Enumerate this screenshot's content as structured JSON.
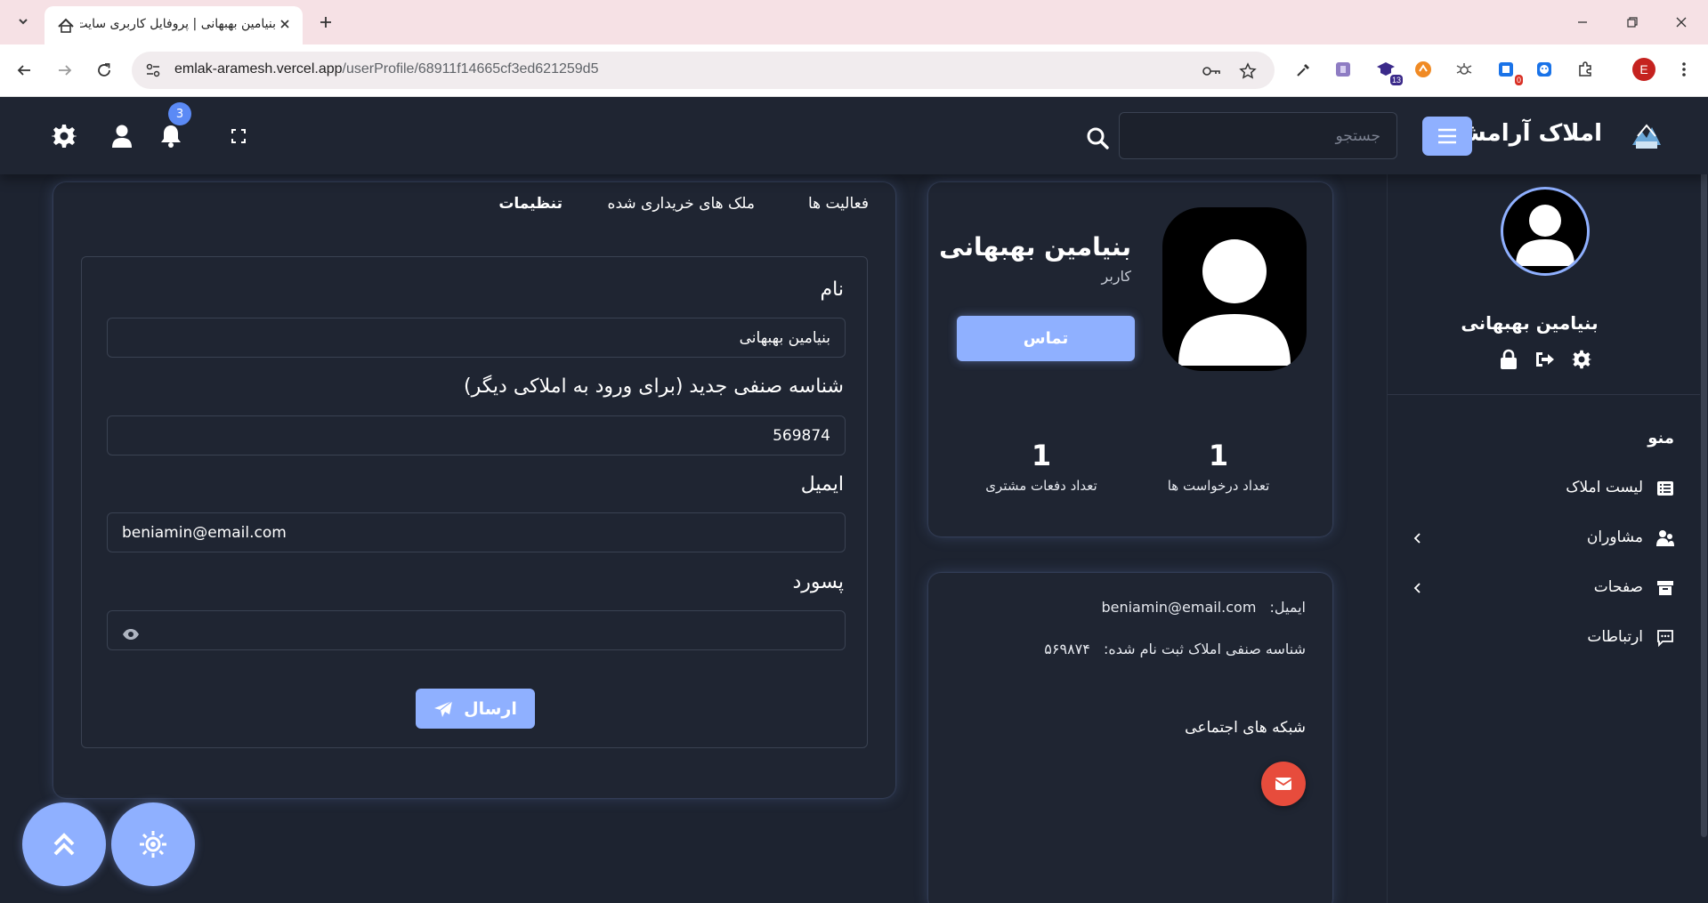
{
  "browser": {
    "tab_title": "بنیامین بهبهانی | پروفایل کاربری سایت املاک",
    "url_host": "emlak-aramesh.vercel.app",
    "url_path": "/userProfile/68911f14665cf3ed621259d5",
    "extension_badges": {
      "ext3": "13",
      "ext6": "0"
    },
    "profile_initial": "E"
  },
  "header": {
    "brand_name": "املاک آرامش",
    "search_placeholder": "جستجو",
    "notification_count": "3"
  },
  "sidebar": {
    "user_name": "بنیامین بهبهانی",
    "menu_title": "منو",
    "items": [
      {
        "label": "لیست املاک",
        "icon": "list-icon"
      },
      {
        "label": "مشاوران",
        "icon": "users-icon"
      },
      {
        "label": "صفحات",
        "icon": "archive-icon"
      },
      {
        "label": "ارتباطات",
        "icon": "chat-icon"
      }
    ]
  },
  "profile_card": {
    "name": "بنیامین بهبهانی",
    "role": "کاربر",
    "contact_button": "تماس",
    "stats": [
      {
        "value": "1",
        "label": "تعداد درخواست ها"
      },
      {
        "value": "1",
        "label": "تعداد دفعات مشتری"
      }
    ]
  },
  "info_card": {
    "email_label": "ایمیل:",
    "email_value": "beniamin@email.com",
    "id_label": "شناسه صنفی املاک ثبت نام شده:",
    "id_value": "۵۶۹۸۷۴",
    "social_title": "شبکه های اجتماعی"
  },
  "settings": {
    "tabs": [
      {
        "label": "فعالیت ها"
      },
      {
        "label": "ملک های خریداری شده"
      },
      {
        "label": "تنظیمات"
      }
    ],
    "name_label": "نام",
    "name_value": "بنیامین بهبهانی",
    "id_label": "شناسه صنفی جدید (برای ورود به املاکی دیگر)",
    "id_value": "569874",
    "email_label": "ایمیل",
    "email_value": "beniamin@email.com",
    "password_label": "پسورد",
    "password_value": "",
    "submit_label": "ارسال"
  },
  "colors": {
    "accent": "#8fb0ff",
    "background": "#1d2330",
    "card": "#1f2532",
    "danger": "#e74c3c"
  }
}
